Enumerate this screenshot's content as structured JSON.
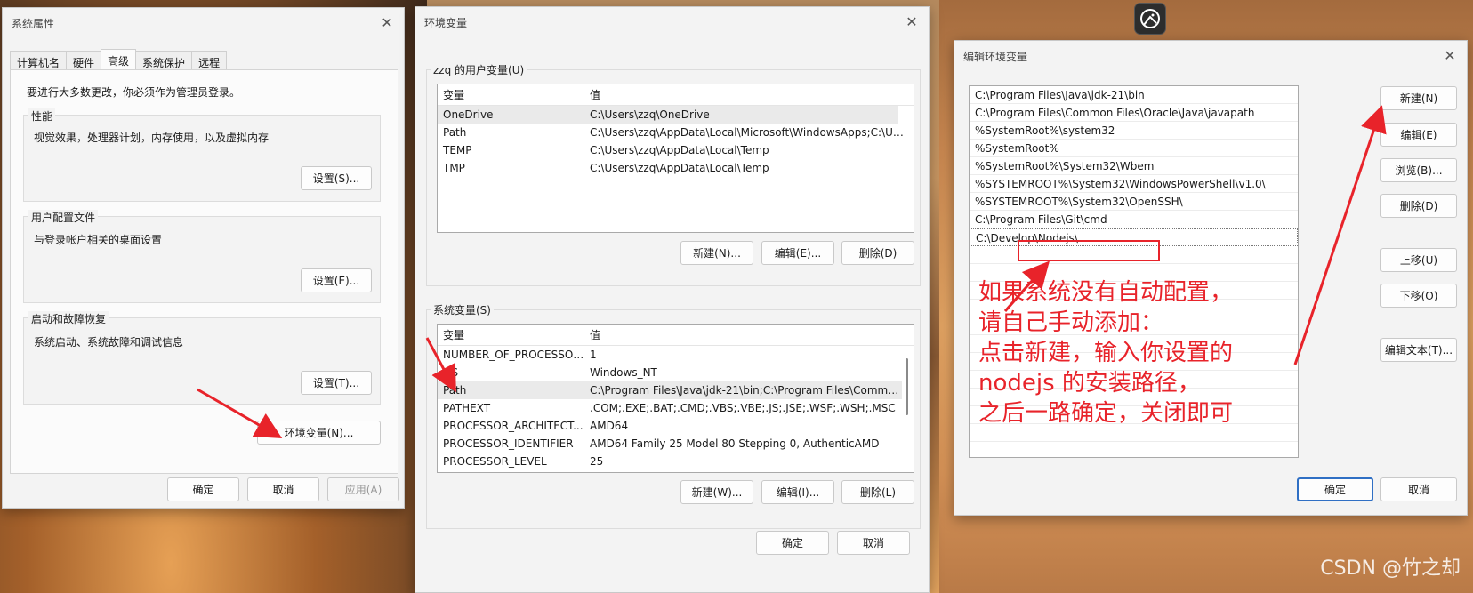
{
  "sysprops": {
    "title": "系统属性",
    "tabs": [
      "计算机名",
      "硬件",
      "高级",
      "系统保护",
      "远程"
    ],
    "admin_note": "要进行大多数更改，你必须作为管理员登录。",
    "performance": {
      "title": "性能",
      "desc": "视觉效果，处理器计划，内存使用，以及虚拟内存",
      "button": "设置(S)..."
    },
    "profile": {
      "title": "用户配置文件",
      "desc": "与登录帐户相关的桌面设置",
      "button": "设置(E)..."
    },
    "startup": {
      "title": "启动和故障恢复",
      "desc": "系统启动、系统故障和调试信息",
      "button": "设置(T)..."
    },
    "env_button": "环境变量(N)...",
    "ok": "确定",
    "cancel": "取消",
    "apply": "应用(A)"
  },
  "envvars": {
    "title": "环境变量",
    "user_section": "zzq 的用户变量(U)",
    "col_var": "变量",
    "col_val": "值",
    "user_vars": [
      {
        "name": "OneDrive",
        "value": "C:\\Users\\zzq\\OneDrive"
      },
      {
        "name": "Path",
        "value": "C:\\Users\\zzq\\AppData\\Local\\Microsoft\\WindowsApps;C:\\Use..."
      },
      {
        "name": "TEMP",
        "value": "C:\\Users\\zzq\\AppData\\Local\\Temp"
      },
      {
        "name": "TMP",
        "value": "C:\\Users\\zzq\\AppData\\Local\\Temp"
      }
    ],
    "user_new": "新建(N)...",
    "user_edit": "编辑(E)...",
    "user_delete": "删除(D)",
    "sys_section": "系统变量(S)",
    "sys_vars": [
      {
        "name": "NUMBER_OF_PROCESSORS",
        "value": "1"
      },
      {
        "name": "OS",
        "value": "Windows_NT"
      },
      {
        "name": "Path",
        "value": "C:\\Program Files\\Java\\jdk-21\\bin;C:\\Program Files\\Common ..."
      },
      {
        "name": "PATHEXT",
        "value": ".COM;.EXE;.BAT;.CMD;.VBS;.VBE;.JS;.JSE;.WSF;.WSH;.MSC"
      },
      {
        "name": "PROCESSOR_ARCHITECT...",
        "value": "AMD64"
      },
      {
        "name": "PROCESSOR_IDENTIFIER",
        "value": "AMD64 Family 25 Model 80 Stepping 0, AuthenticAMD"
      },
      {
        "name": "PROCESSOR_LEVEL",
        "value": "25"
      }
    ],
    "sys_new": "新建(W)...",
    "sys_edit": "编辑(I)...",
    "sys_delete": "删除(L)",
    "ok": "确定",
    "cancel": "取消"
  },
  "editenv": {
    "title": "编辑环境变量",
    "paths": [
      "C:\\Program Files\\Java\\jdk-21\\bin",
      "C:\\Program Files\\Common Files\\Oracle\\Java\\javapath",
      "%SystemRoot%\\system32",
      "%SystemRoot%",
      "%SystemRoot%\\System32\\Wbem",
      "%SYSTEMROOT%\\System32\\WindowsPowerShell\\v1.0\\",
      "%SYSTEMROOT%\\System32\\OpenSSH\\",
      "C:\\Program Files\\Git\\cmd",
      "C:\\Develop\\Nodejs\\"
    ],
    "buttons": {
      "new": "新建(N)",
      "edit": "编辑(E)",
      "browse": "浏览(B)...",
      "delete": "删除(D)",
      "move_up": "上移(U)",
      "move_down": "下移(O)",
      "edit_text": "编辑文本(T)..."
    },
    "ok": "确定",
    "cancel": "取消"
  },
  "annotation": [
    "如果系统没有自动配置，",
    "请自己手动添加：",
    "点击新建，输入你设置的",
    "nodejs 的安装路径，",
    "之后一路确定，关闭即可"
  ],
  "watermark": "CSDN @竹之却",
  "colors": {
    "annotation": "#e8232a",
    "accent": "#2f6fc4"
  },
  "icons": {
    "top_app": "app-circle-icon"
  }
}
